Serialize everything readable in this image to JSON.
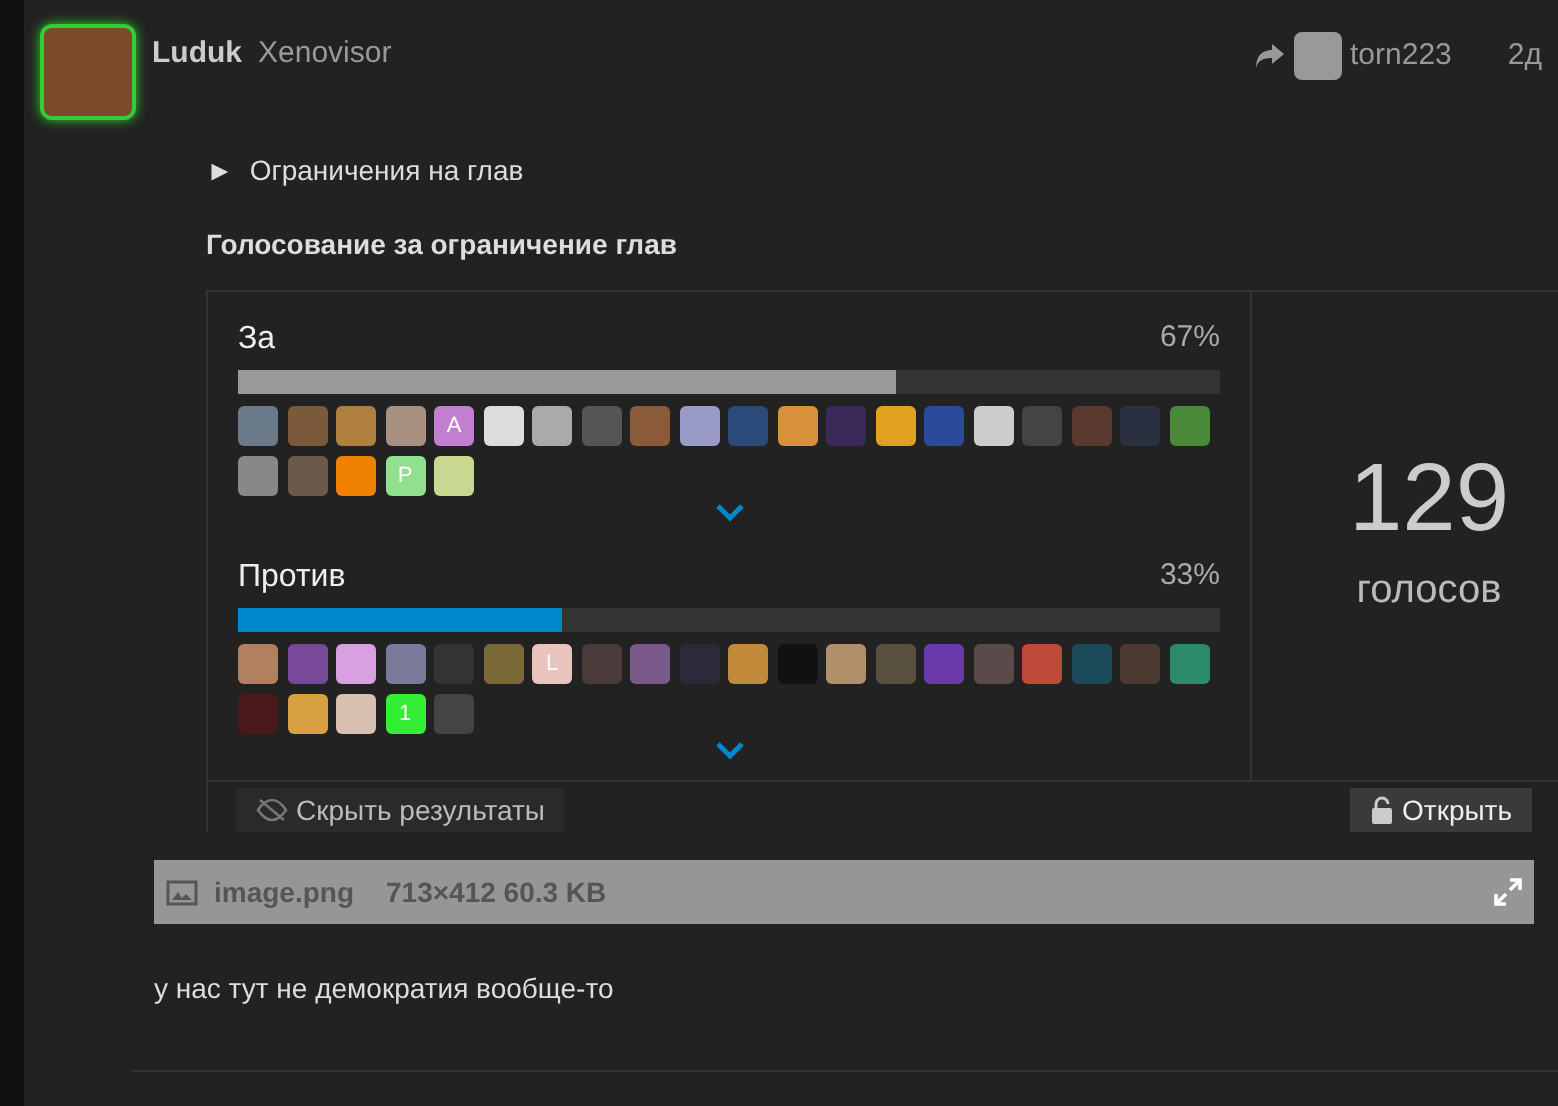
{
  "post": {
    "author": "Luduk",
    "title": "Xenovisor",
    "reply_to": "torn223",
    "time": "2д"
  },
  "image": {
    "details_summary": "Ограничения на глав",
    "details_marker": "►",
    "poll": {
      "title": "Голосование за ограничение глав",
      "options": [
        {
          "label": "За",
          "percent": "67%",
          "level": 0.67,
          "kind": "plain",
          "voters": [
            {
              "kind": "image",
              "color": "#6a7a88"
            },
            {
              "kind": "image",
              "color": "#7a5a3a"
            },
            {
              "kind": "image",
              "color": "#b08040"
            },
            {
              "kind": "image",
              "color": "#a89080"
            },
            {
              "kind": "letter",
              "letter": "A",
              "color": "#c27fcf"
            },
            {
              "kind": "image",
              "color": "#dddddd"
            },
            {
              "kind": "image",
              "color": "#aaaaaa"
            },
            {
              "kind": "image",
              "color": "#555555"
            },
            {
              "kind": "image",
              "color": "#8a5a3a"
            },
            {
              "kind": "image",
              "color": "#9a9ac8"
            },
            {
              "kind": "image",
              "color": "#2a4a7a"
            },
            {
              "kind": "image",
              "color": "#d8903a"
            },
            {
              "kind": "image",
              "color": "#3a2a5a"
            },
            {
              "kind": "image",
              "color": "#e0a020"
            },
            {
              "kind": "image",
              "color": "#2a4a9a"
            },
            {
              "kind": "image",
              "color": "#cccccc"
            },
            {
              "kind": "image",
              "color": "#444444"
            },
            {
              "kind": "image",
              "color": "#5a3a30"
            },
            {
              "kind": "image",
              "color": "#2a3040"
            },
            {
              "kind": "image",
              "color": "#4a8a3a"
            },
            {
              "kind": "image",
              "color": "#888888"
            },
            {
              "kind": "image",
              "color": "#6a5a4a"
            },
            {
              "kind": "image",
              "color": "#f08000"
            },
            {
              "kind": "letter",
              "letter": "P",
              "color": "#90e090"
            },
            {
              "kind": "image",
              "color": "#c8d890"
            }
          ]
        },
        {
          "label": "Против",
          "percent": "33%",
          "level": 0.33,
          "kind": "highlight",
          "voters": [
            {
              "kind": "image",
              "color": "#b08060"
            },
            {
              "kind": "image",
              "color": "#7a4a9a"
            },
            {
              "kind": "image",
              "color": "#d8a0e0"
            },
            {
              "kind": "image",
              "color": "#7a7a9a"
            },
            {
              "kind": "image",
              "color": "#333333"
            },
            {
              "kind": "image",
              "color": "#7a6a3a"
            },
            {
              "kind": "letter",
              "letter": "L",
              "color": "#e8c4bc"
            },
            {
              "kind": "image",
              "color": "#4a3a3a"
            },
            {
              "kind": "image",
              "color": "#7a5a8a"
            },
            {
              "kind": "image",
              "color": "#2a2a3a"
            },
            {
              "kind": "image",
              "color": "#c08a3a"
            },
            {
              "kind": "image",
              "color": "#111111"
            },
            {
              "kind": "image",
              "color": "#b0906a"
            },
            {
              "kind": "image",
              "color": "#5a5040"
            },
            {
              "kind": "image",
              "color": "#6a3aaa"
            },
            {
              "kind": "image",
              "color": "#5a4a4a"
            },
            {
              "kind": "image",
              "color": "#c04a3a"
            },
            {
              "kind": "image",
              "color": "#1a4a5a"
            },
            {
              "kind": "image",
              "color": "#4a3a30"
            },
            {
              "kind": "image",
              "color": "#2a8a6a"
            },
            {
              "kind": "image",
              "color": "#4a1a1a"
            },
            {
              "kind": "image",
              "color": "#d8a040"
            },
            {
              "kind": "image",
              "color": "#d8c0b0"
            },
            {
              "kind": "letter",
              "letter": "1",
              "color": "#33ee33"
            },
            {
              "kind": "image",
              "color": "#444444"
            }
          ]
        }
      ],
      "total": "129",
      "total_label": "голосов",
      "hide_button": "Скрыть результаты",
      "open_button": "Открыть"
    },
    "filename": "image.png",
    "file_info": "713×412 60.3 KB"
  },
  "message": "у нас тут не демократия вообще-то"
}
